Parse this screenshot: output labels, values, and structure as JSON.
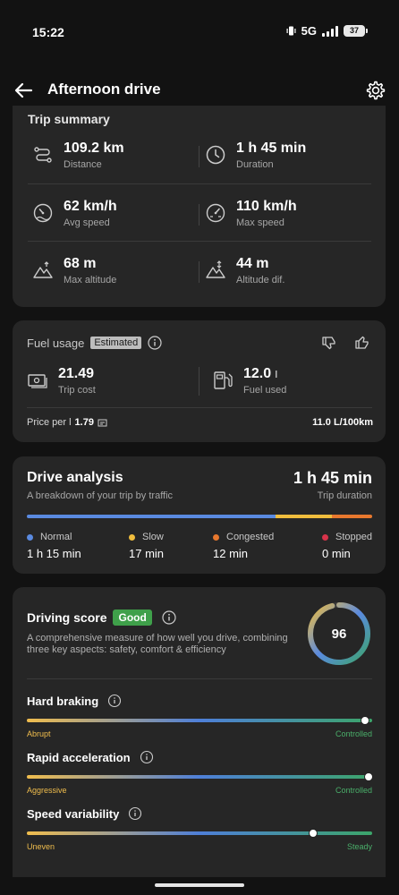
{
  "status_bar": {
    "time": "15:22",
    "network": "5G",
    "battery": "37"
  },
  "header": {
    "title": "Afternoon drive",
    "back_icon": "arrow-left-icon",
    "settings_icon": "gear-icon"
  },
  "trip_summary": {
    "title": "Trip summary",
    "stats": [
      {
        "value": "109.2 km",
        "label": "Distance",
        "icon": "route-icon"
      },
      {
        "value": "1 h 45 min",
        "label": "Duration",
        "icon": "clock-icon"
      },
      {
        "value": "62 km/h",
        "label": "Avg speed",
        "icon": "speedometer-icon"
      },
      {
        "value": "110 km/h",
        "label": "Max speed",
        "icon": "speedometer-max-icon"
      },
      {
        "value": "68 m",
        "label": "Max altitude",
        "icon": "mountain-icon"
      },
      {
        "value": "44 m",
        "label": "Altitude dif.",
        "icon": "mountain-diff-icon"
      }
    ]
  },
  "fuel_usage": {
    "title": "Fuel usage",
    "badge": "Estimated",
    "trip_cost_value": "21.49",
    "trip_cost_label": "Trip cost",
    "fuel_used_value": "12.0",
    "fuel_used_unit": "l",
    "fuel_used_label": "Fuel used",
    "price_label": "Price per l",
    "price_value": "1.79",
    "consumption": "11.0 L/100km"
  },
  "drive_analysis": {
    "title": "Drive analysis",
    "subtitle": "A breakdown of your trip by traffic",
    "duration": "1 h 45 min",
    "duration_label": "Trip duration",
    "segments": [
      {
        "name": "Normal",
        "value": "1 h 15 min",
        "minutes": 75,
        "color": "#5a8ae0"
      },
      {
        "name": "Slow",
        "value": "17 min",
        "minutes": 17,
        "color": "#f0bd3d"
      },
      {
        "name": "Congested",
        "value": "12 min",
        "minutes": 12,
        "color": "#e8782e"
      },
      {
        "name": "Stopped",
        "value": "0 min",
        "minutes": 0,
        "color": "#d8334a"
      }
    ]
  },
  "driving_score": {
    "title": "Driving score",
    "badge": "Good",
    "description": "A comprehensive measure of how well you drive, combining three key aspects: safety, comfort & efficiency",
    "score": "96",
    "score_fraction": 0.96,
    "metrics": [
      {
        "name": "Hard braking",
        "low": "Abrupt",
        "high": "Controlled",
        "level": 0.98
      },
      {
        "name": "Rapid acceleration",
        "low": "Aggressive",
        "high": "Controlled",
        "level": 0.99
      },
      {
        "name": "Speed variability",
        "low": "Uneven",
        "high": "Steady",
        "level": 0.83
      }
    ]
  }
}
